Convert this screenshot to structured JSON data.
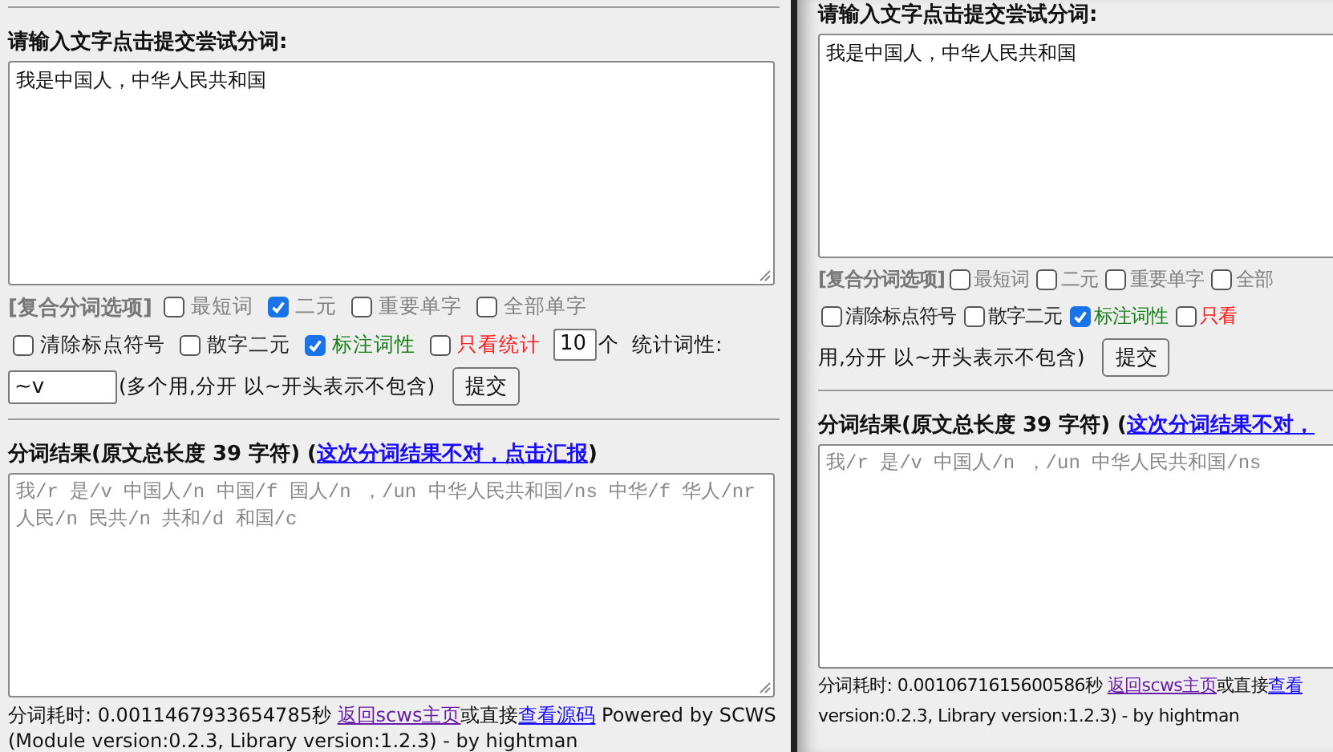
{
  "panels": [
    {
      "heading": "请输入文字点击提交尝试分词:",
      "input_text": "我是中国人，中华人民共和国",
      "options_rows": [
        [
          {
            "kind": "label",
            "text": "[复合分词选项]"
          },
          {
            "kind": "checkbox",
            "label": "最短词",
            "checked": false,
            "color": "#808080"
          },
          {
            "kind": "checkbox",
            "label": "二元",
            "checked": true,
            "color": "#808080"
          },
          {
            "kind": "checkbox",
            "label": "重要单字",
            "checked": false,
            "color": "#808080"
          },
          {
            "kind": "checkbox",
            "label": "全部单字",
            "checked": false,
            "color": "#808080"
          }
        ],
        [
          {
            "kind": "checkbox",
            "label": "清除标点符号",
            "checked": false,
            "color": "#222222"
          },
          {
            "kind": "checkbox",
            "label": "散字二元",
            "checked": false,
            "color": "#222222"
          },
          {
            "kind": "checkbox",
            "label": "标注词性",
            "checked": true,
            "color": "#1a7f1a"
          },
          {
            "kind": "checkbox",
            "label": "只看统计",
            "checked": false,
            "color": "#ff2020"
          },
          {
            "kind": "number",
            "value": "10"
          },
          {
            "kind": "text",
            "text": "个"
          },
          {
            "kind": "text",
            "text": "统计词性:"
          }
        ],
        [
          {
            "kind": "field",
            "value": "~v"
          },
          {
            "kind": "text",
            "text": "(多个用,分开 以~开头表示不包含)"
          },
          {
            "kind": "button",
            "label": "提交"
          }
        ]
      ],
      "result_heading": "分词结果(原文总长度 39 字符) (",
      "report_link": "这次分词结果不对，点击汇报",
      "report_close": ")",
      "result_text": "我/r 是/v 中国人/n 中国/f 国人/n ，/un 中华人民共和国/ns 中华/f 华人/nr 人民/n 民共/n 共和/d 和国/c",
      "footer_lines": [
        [
          {
            "kind": "text",
            "text": "分词耗时: 0.0011467933654785秒 "
          },
          {
            "kind": "link",
            "text": "返回scws主页",
            "visited": true
          },
          {
            "kind": "text",
            "text": "或直接"
          },
          {
            "kind": "link",
            "text": "查看源码",
            "visited": false
          },
          {
            "kind": "text",
            "text": " Powered by SCWS (Module version:0.2.3, Library version:1.2.3) - by hightman"
          }
        ]
      ]
    },
    {
      "heading": "请输入文字点击提交尝试分词:",
      "input_text": "我是中国人，中华人民共和国",
      "options_rows": [
        [
          {
            "kind": "label",
            "text": "[复合分词选项]"
          },
          {
            "kind": "checkbox",
            "label": "最短词",
            "checked": false,
            "color": "#808080"
          },
          {
            "kind": "checkbox",
            "label": "二元",
            "checked": false,
            "color": "#808080"
          },
          {
            "kind": "checkbox",
            "label": "重要单字",
            "checked": false,
            "color": "#808080"
          },
          {
            "kind": "checkbox",
            "label": "全部",
            "checked": false,
            "color": "#808080"
          }
        ],
        [
          {
            "kind": "checkbox",
            "label": "清除标点符号",
            "checked": false,
            "color": "#222222"
          },
          {
            "kind": "checkbox",
            "label": "散字二元",
            "checked": false,
            "color": "#222222"
          },
          {
            "kind": "checkbox",
            "label": "标注词性",
            "checked": true,
            "color": "#1a7f1a"
          },
          {
            "kind": "checkbox",
            "label": "只看",
            "checked": false,
            "color": "#ff2020"
          }
        ],
        [
          {
            "kind": "text",
            "text": "用,分开 以~开头表示不包含)"
          },
          {
            "kind": "button",
            "label": "提交"
          }
        ]
      ],
      "result_heading": "分词结果(原文总长度 39 字符) (",
      "report_link": "这次分词结果不对，",
      "result_text": "我/r 是/v 中国人/n ，/un 中华人民共和国/ns",
      "footer_lines": [
        [
          {
            "kind": "text",
            "text": "分词耗时: 0.0010671615600586秒 "
          },
          {
            "kind": "link",
            "text": "返回scws主页",
            "visited": true
          },
          {
            "kind": "text",
            "text": "或直接"
          },
          {
            "kind": "link",
            "text": "查看",
            "visited": false
          }
        ],
        [
          {
            "kind": "text",
            "text": "version:0.2.3, Library version:1.2.3) - by hightman"
          }
        ]
      ]
    }
  ]
}
